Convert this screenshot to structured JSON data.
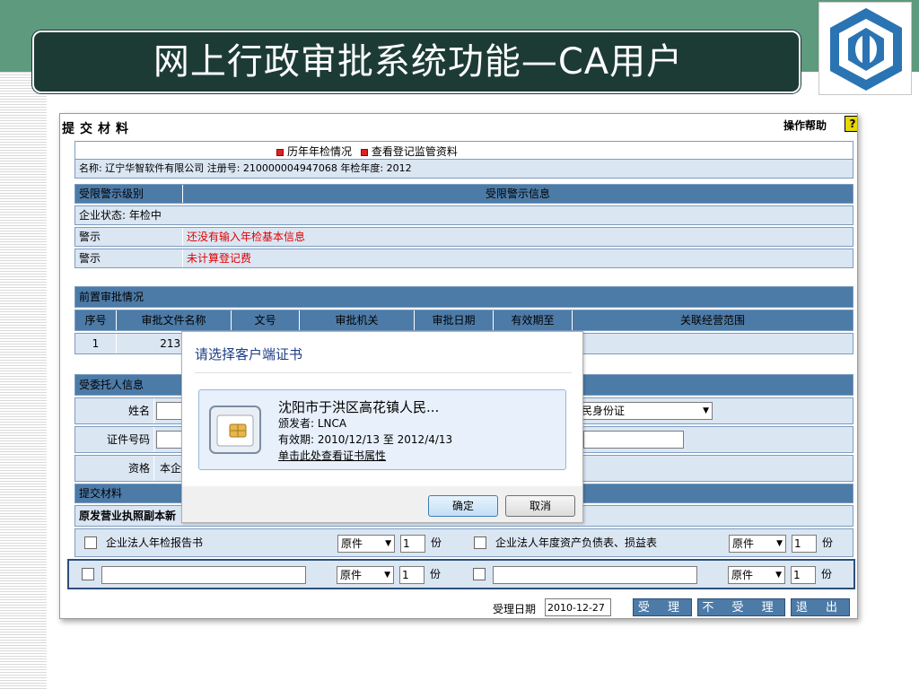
{
  "slide": {
    "title": "网上行政审批系统功能—CA用户",
    "colors": {
      "band": "#5e9a7e",
      "title_bg": "#1c3b35",
      "header_blue": "#4d7ba8",
      "row_light": "#dbe6f3"
    }
  },
  "page": {
    "title": "提交材料",
    "help_label": "操作帮助",
    "help_icon": "?",
    "links": [
      "历年年检情况",
      "查看登记监管资料"
    ],
    "company_line": "名称: 辽宁华智软件有限公司 注册号: 210000004947068 年检年度: 2012"
  },
  "warnings": {
    "col_level": "受限警示级别",
    "col_info": "受限警示信息",
    "status": "企业状态: 年检中",
    "rows": [
      {
        "level": "警示",
        "info": "还没有输入年检基本信息"
      },
      {
        "level": "警示",
        "info": "未计算登记费"
      }
    ]
  },
  "pre_approval": {
    "title": "前置审批情况",
    "headers": [
      "序号",
      "审批文件名称",
      "文号",
      "审批机关",
      "审批日期",
      "有效期至",
      "关联经营范围"
    ],
    "row": {
      "seq": "1",
      "name": "2132"
    }
  },
  "trustee": {
    "title": "受委托人信息",
    "name_label": "姓名",
    "id_label": "证件号码",
    "qual_label": "资格",
    "qual_value": "本企",
    "id_type_value": "民身份证"
  },
  "materials": {
    "title": "提交材料",
    "subtitle": "原发营业执照副本新",
    "items": [
      {
        "name": "企业法人年检报告书",
        "type": "原件",
        "qty": "1",
        "unit": "份"
      },
      {
        "name": "企业法人年度资产负债表、损益表",
        "type": "原件",
        "qty": "1",
        "unit": "份"
      },
      {
        "name": "",
        "type": "原件",
        "qty": "1",
        "unit": "份"
      },
      {
        "name": "",
        "type": "原件",
        "qty": "1",
        "unit": "份"
      }
    ]
  },
  "footer": {
    "date_label": "受理日期",
    "date_value": "2010-12-27",
    "accept": "受 理",
    "reject": "不 受 理",
    "exit": "退 出"
  },
  "dialog": {
    "title": "请选择客户端证书",
    "cert_name": "沈阳市于洪区高花镇人民...",
    "issuer": "颁发者: LNCA",
    "validity": "有效期: 2010/12/13 至 2012/4/13",
    "link": "单击此处查看证书属性",
    "ok": "确定",
    "cancel": "取消"
  }
}
